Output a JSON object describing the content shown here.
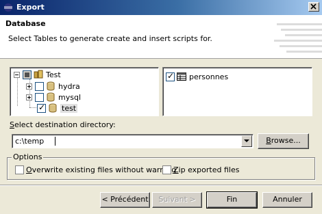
{
  "window": {
    "title": "Export"
  },
  "header": {
    "heading": "Database",
    "description": "Select Tables to generate create and insert scripts for."
  },
  "tree": {
    "root": {
      "label": "Test",
      "state": "partial"
    },
    "children": [
      {
        "label": "hydra",
        "checked": false,
        "expandable": true
      },
      {
        "label": "mysql",
        "checked": false,
        "expandable": true
      },
      {
        "label": "test",
        "checked": true,
        "expandable": false,
        "selected": true
      }
    ]
  },
  "tables": [
    {
      "label": "personnes",
      "checked": true
    }
  ],
  "destination": {
    "label_prefix": "S",
    "label_rest": "elect destination directory:",
    "value": "c:\\temp",
    "browse_label_prefix": "B",
    "browse_label_rest": "rowse..."
  },
  "options": {
    "legend": "Options",
    "overwrite_prefix": "O",
    "overwrite_rest": "verwrite existing files without warning",
    "overwrite_checked": false,
    "zip_prefix": "Z",
    "zip_rest": "ip exported files",
    "zip_checked": false
  },
  "buttons": {
    "back": "< Précédent",
    "next": "Suivant >",
    "finish": "Fin",
    "cancel": "Annuler"
  }
}
